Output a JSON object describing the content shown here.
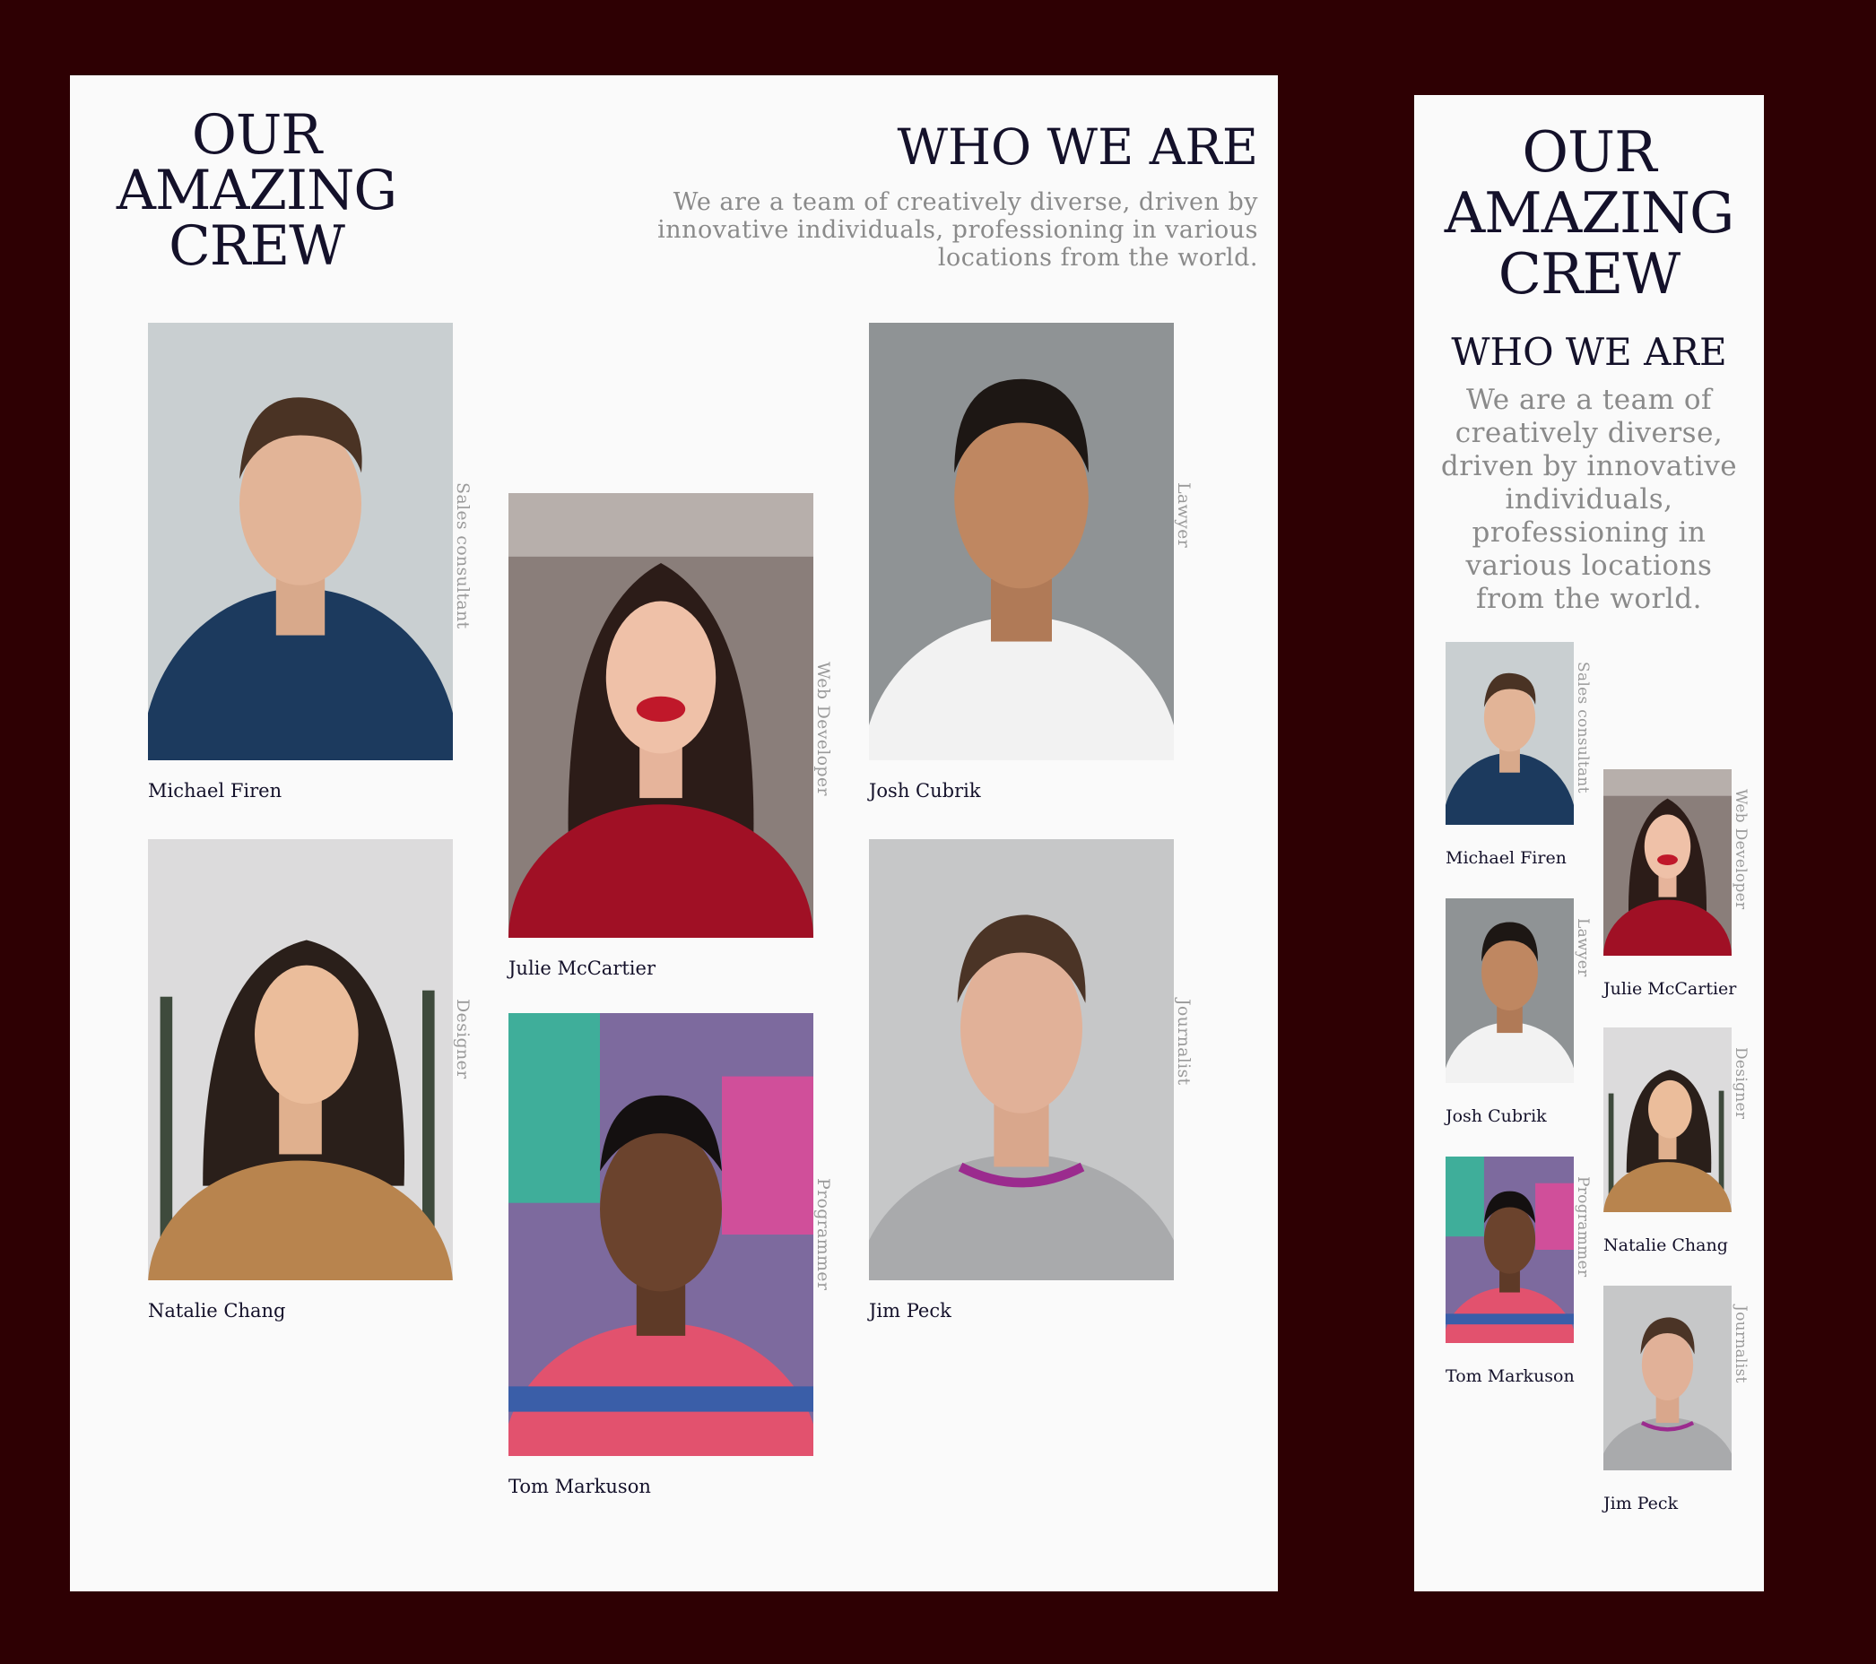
{
  "desktop": {
    "heading": "OUR AMAZING CREW",
    "subheading": "WHO WE ARE",
    "description": "We are a team of creatively diverse, driven by innovative individuals, professioning in various locations from the world."
  },
  "mobile": {
    "heading": "OUR AMAZING CREW",
    "subheading": "WHO WE ARE",
    "description": "We are a team of creatively diverse, driven by innovative individuals, professioning in various locations from the world."
  },
  "crew": [
    {
      "name": "Michael Firen",
      "role": "Sales consultant"
    },
    {
      "name": "Julie McCartier",
      "role": "Web Developer"
    },
    {
      "name": "Josh Cubrik",
      "role": "Lawyer"
    },
    {
      "name": "Natalie Chang",
      "role": "Designer"
    },
    {
      "name": "Tom Markuson",
      "role": "Programmer"
    },
    {
      "name": "Jim Peck",
      "role": "Journalist"
    }
  ]
}
